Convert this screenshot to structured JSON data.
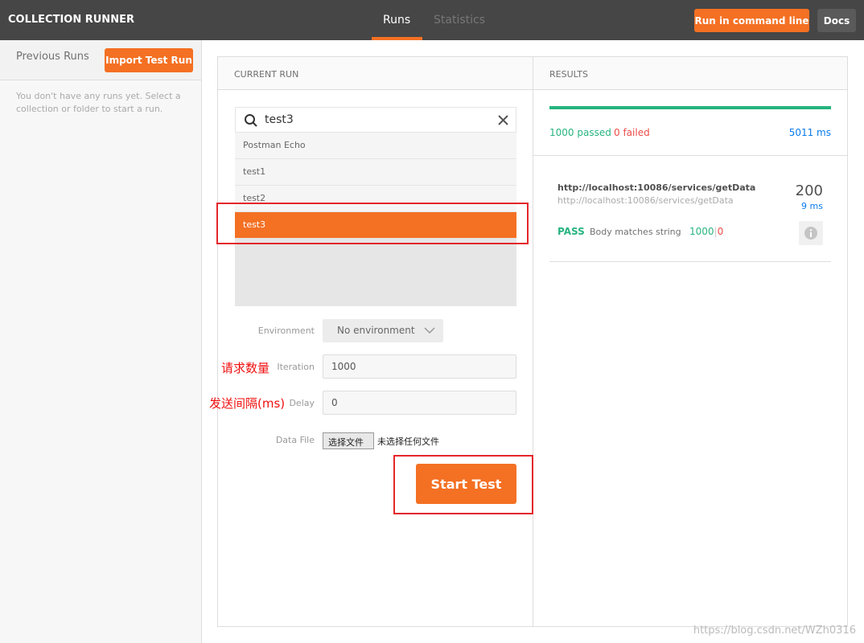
{
  "header": {
    "title": "COLLECTION RUNNER",
    "tabs": [
      {
        "label": "Runs",
        "active": true
      },
      {
        "label": "Statistics",
        "active": false
      }
    ],
    "run_cmd_label": "Run in command line",
    "docs_label": "Docs"
  },
  "sidebar": {
    "title": "Previous Runs",
    "import_label": "Import Test Run",
    "empty_text": "You don't have any runs yet. Select a collection or folder to start a run."
  },
  "current_run": {
    "heading": "CURRENT RUN",
    "search_value": "test3",
    "collections": [
      {
        "label": "Postman Echo"
      },
      {
        "label": "test1"
      },
      {
        "label": "test2"
      },
      {
        "label": "test3",
        "selected": true
      }
    ],
    "environment": {
      "label": "Environment",
      "value": "No environment"
    },
    "iteration": {
      "label": "Iteration",
      "value": "1000",
      "annotation": "请求数量"
    },
    "delay": {
      "label": "Delay",
      "value": "0",
      "annotation": "发送间隔(ms)"
    },
    "data_file": {
      "label": "Data File",
      "button": "选择文件",
      "status": "未选择任何文件"
    },
    "start_label": "Start Test"
  },
  "results": {
    "heading": "RESULTS",
    "progress": 1.0,
    "passed": "1000 passed",
    "failed": "0 failed",
    "duration": "5011 ms",
    "request": {
      "name": "http://localhost:10086/services/getData",
      "url": "http://localhost:10086/services/getData",
      "status": "200",
      "time": "9 ms",
      "test": {
        "result": "PASS",
        "name": "Body matches string",
        "pass_count": "1000",
        "sep": "|",
        "fail_count": "0"
      }
    }
  },
  "watermark": "https://blog.csdn.net/WZh0316",
  "colors": {
    "accent": "#f47023",
    "pass": "#26b47f",
    "fail": "#ed4b48",
    "time": "#097bed",
    "annotation": "#e4262a"
  }
}
